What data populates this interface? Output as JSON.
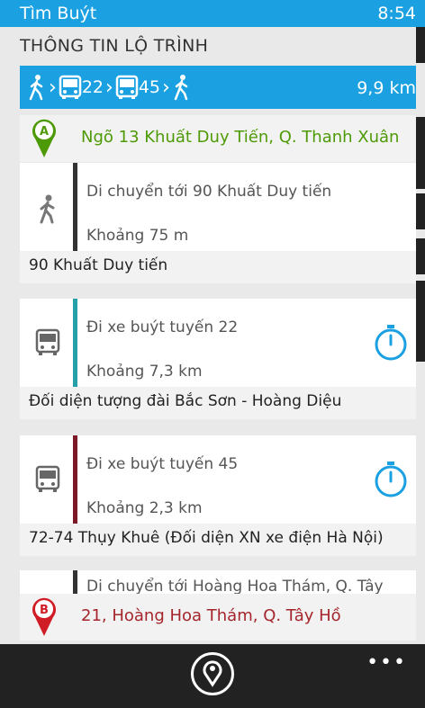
{
  "status_bar": {
    "app_name": "Tìm Buýt",
    "time": "8:54"
  },
  "page_title": "THÔNG TIN LỘ TRÌNH",
  "summary": {
    "route_numbers": [
      "22",
      "45"
    ],
    "distance": "9,9 km",
    "color": "#1ba1e2"
  },
  "origin": {
    "marker": "A",
    "address": "Ngõ 13 Khuất Duy Tiến, Q. Thanh Xuân",
    "color": "#4e9a06"
  },
  "steps": [
    {
      "icon": "walk-icon",
      "instruction": "Di chuyển tới 90 Khuất Duy tiến",
      "distance": "Khoảng 75 m",
      "bar_color": "#333333",
      "stop": "90 Khuất Duy tiến"
    },
    {
      "icon": "bus-icon",
      "instruction": "Đi xe buýt tuyến 22",
      "distance": "Khoảng 7,3 km",
      "bar_color": "#26a0a8",
      "stop": "Đối diện tượng đài Bắc Sơn - Hoàng Diệu"
    },
    {
      "icon": "bus-icon",
      "instruction": "Đi xe buýt tuyến 45",
      "distance": "Khoảng 2,3 km",
      "bar_color": "#7b1a26",
      "stop": "72-74 Thụy Khuê (Đối diện XN xe điện Hà Nội)"
    },
    {
      "icon": "walk-icon",
      "instruction": "Di chuyển tới Hoàng Hoa Thám, Q. Tây",
      "bar_color": "#333333"
    }
  ],
  "destination": {
    "marker": "B",
    "address": "21, Hoàng Hoa Thám, Q. Tây Hồ",
    "color": "#a4252b"
  },
  "app_bar": {
    "primary_icon": "location-pin-icon",
    "more_label": "•••"
  }
}
